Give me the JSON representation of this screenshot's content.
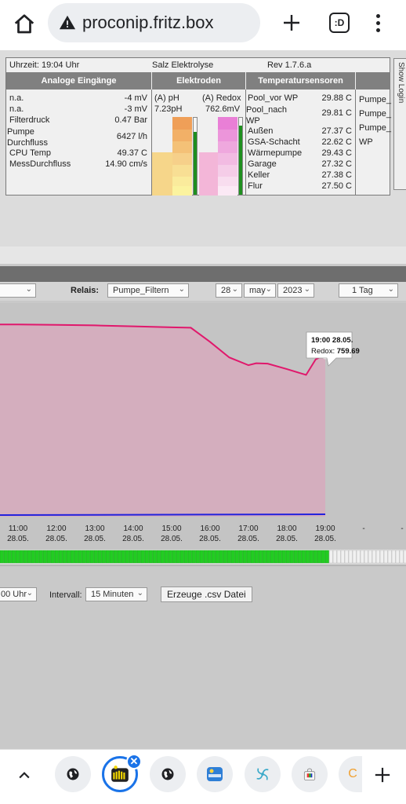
{
  "browser": {
    "url": "proconip.fritz.box",
    "tabs_button_label": ":D"
  },
  "status": {
    "time": "Uhrzeit: 19:04 Uhr",
    "mode": "Salz Elektrolyse",
    "version": "Rev 1.7.6.a",
    "show_login": "Show Login",
    "headers": {
      "analog": "Analoge Eingänge",
      "electrodes": "Elektroden",
      "temps": "Temperatursensoren"
    },
    "analog": [
      {
        "name": "n.a.",
        "value": "-4 mV"
      },
      {
        "name": "n.a.",
        "value": "-3 mV"
      },
      {
        "name": "Filterdruck",
        "value": "0.47 Bar"
      },
      {
        "name": "Pumpe Durchfluss",
        "value": "6427 l/h"
      },
      {
        "name": "CPU Temp",
        "value": "49.37 C"
      },
      {
        "name": "MessDurchfluss",
        "value": "14.90 cm/s"
      }
    ],
    "electrodes": {
      "ph_label": "(A) pH",
      "ph_value": "7.23pH",
      "redox_label": "(A) Redox",
      "redox_value": "762.6mV",
      "ph_level": 0.82,
      "redox_level": 0.9
    },
    "temps": [
      {
        "name": "Pool_vor WP",
        "value": "29.88 C"
      },
      {
        "name": "Pool_nach WP",
        "value": "29.81 C"
      },
      {
        "name": "Außen",
        "value": "27.37 C"
      },
      {
        "name": "GSA-Schacht",
        "value": "22.62 C"
      },
      {
        "name": "Wärmepumpe",
        "value": "29.43 C"
      },
      {
        "name": "Garage",
        "value": "27.32 C"
      },
      {
        "name": "Keller",
        "value": "27.38 C"
      },
      {
        "name": "Flur",
        "value": "27.50 C"
      }
    ],
    "relays": [
      "Pumpe_",
      "Pumpe_",
      "Pumpe_",
      "WP"
    ]
  },
  "selector": {
    "relais_label": "Relais:",
    "relais_value": "Pumpe_Filtern",
    "day": "28",
    "month": "may",
    "year": "2023",
    "range": "1 Tag"
  },
  "chart_data": {
    "type": "line",
    "x": [
      "11:00 28.05.",
      "12:00 28.05.",
      "13:00 28.05.",
      "14:00 28.05.",
      "15:00 28.05.",
      "16:00 28.05.",
      "17:00 28.05.",
      "18:00 28.05.",
      "19:00 28.05.",
      "-",
      "-"
    ],
    "x_ticks": [
      {
        "time": "11:00",
        "date": "28.05."
      },
      {
        "time": "12:00",
        "date": "28.05."
      },
      {
        "time": "13:00",
        "date": "28.05."
      },
      {
        "time": "14:00",
        "date": "28.05."
      },
      {
        "time": "15:00",
        "date": "28.05."
      },
      {
        "time": "16:00",
        "date": "28.05."
      },
      {
        "time": "17:00",
        "date": "28.05."
      },
      {
        "time": "18:00",
        "date": "28.05."
      },
      {
        "time": "19:00",
        "date": "28.05."
      },
      {
        "time": "-",
        "date": ""
      },
      {
        "time": "-",
        "date": ""
      }
    ],
    "series": [
      {
        "name": "Redox",
        "color": "#e0186c",
        "points": [
          [
            10.5,
            789
          ],
          [
            11,
            789
          ],
          [
            12,
            788.8
          ],
          [
            13,
            788.5
          ],
          [
            14,
            788
          ],
          [
            15,
            787.5
          ],
          [
            15.5,
            787.3
          ],
          [
            16,
            780
          ],
          [
            16.5,
            772
          ],
          [
            17,
            768
          ],
          [
            17.2,
            769
          ],
          [
            17.5,
            768.8
          ],
          [
            18,
            766
          ],
          [
            18.5,
            763
          ],
          [
            18.75,
            771
          ],
          [
            19,
            773.5
          ]
        ]
      },
      {
        "name": "pH",
        "color": "#2222dd",
        "points": [
          [
            10.5,
            0.6
          ],
          [
            19,
            0.7
          ]
        ]
      }
    ],
    "tooltip": {
      "time": "19:00 28.05.",
      "label": "Redox: ",
      "value": "759.69"
    },
    "yrange": [
      690,
      800
    ],
    "xrange": [
      10.5,
      20.3
    ],
    "legend": "none",
    "grid": false
  },
  "timeline": {
    "green_slots": 84,
    "total_slots": 104
  },
  "export": {
    "start_time": "00 Uhr",
    "interval_label": "Intervall:",
    "interval_value": "15 Minuten",
    "csv_button": "Erzeuge .csv Datei"
  }
}
